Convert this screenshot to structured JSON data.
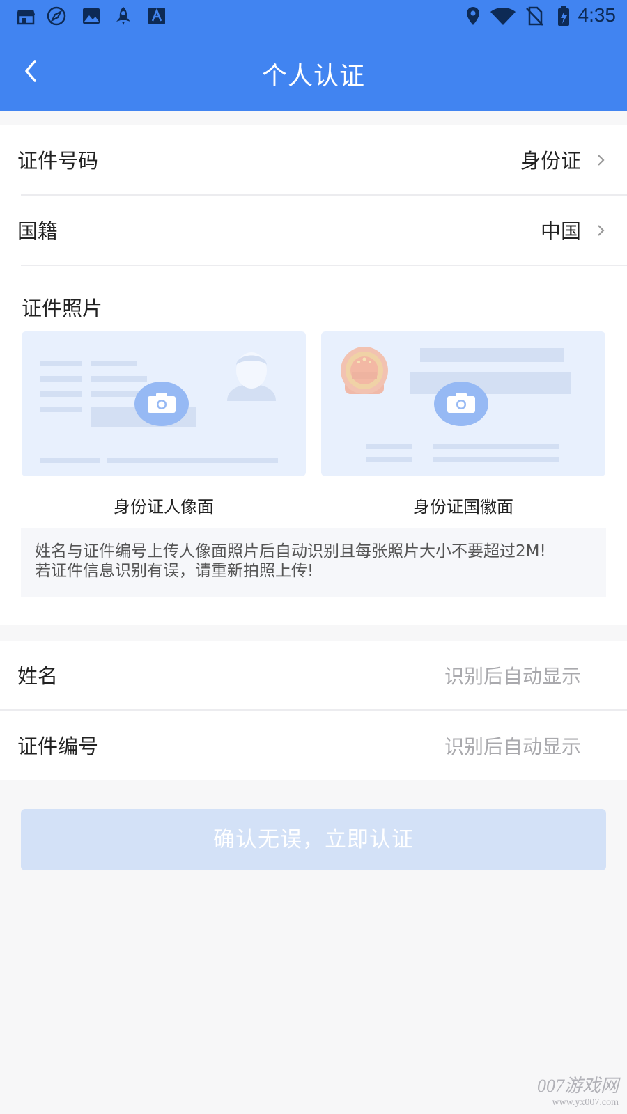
{
  "status_bar": {
    "time": "4:35",
    "left_icons": [
      "store-icon",
      "compass-icon",
      "image-icon",
      "rocket-icon",
      "font-icon"
    ],
    "right_icons": [
      "location-icon",
      "wifi-icon",
      "no-sim-icon",
      "battery-charging-icon"
    ]
  },
  "header": {
    "title": "个人认证",
    "back_icon": "chevron-left-icon"
  },
  "id_type": {
    "label": "证件号码",
    "value": "身份证"
  },
  "nationality": {
    "label": "国籍",
    "value": "中国"
  },
  "photos": {
    "title": "证件照片",
    "front_caption": "身份证人像面",
    "back_caption": "身份证国徽面"
  },
  "notice": {
    "line1": "姓名与证件编号上传人像面照片后自动识别且每张照片大小不要超过2M!",
    "line2": "若证件信息识别有误，请重新拍照上传!"
  },
  "name_field": {
    "label": "姓名",
    "placeholder": "识别后自动显示"
  },
  "id_number_field": {
    "label": "证件编号",
    "placeholder": "识别后自动显示"
  },
  "confirm_button": {
    "label": "确认无误，立即认证"
  },
  "watermark": {
    "big": "007游戏网",
    "small": "www.yx007.com"
  },
  "colors": {
    "primary": "#4184f1",
    "disabled_button": "#d3e1f7",
    "card_bg": "#e8f0fd",
    "camera_bg": "#96b9f4"
  }
}
